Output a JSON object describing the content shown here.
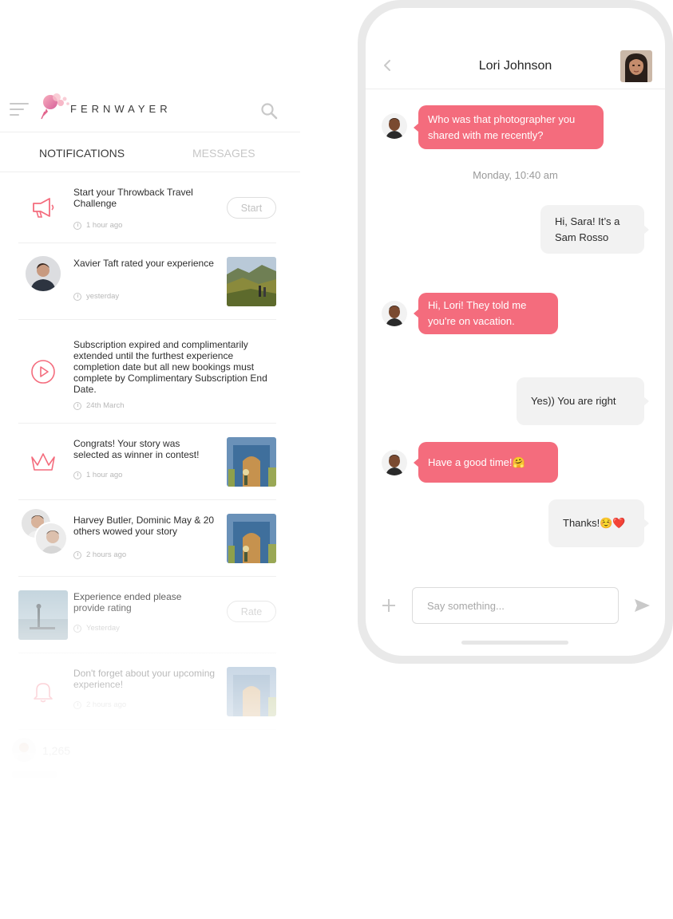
{
  "app": {
    "brand": "FERNWAYER",
    "tabs": [
      {
        "label": "NOTIFICATIONS",
        "active": true
      },
      {
        "label": "MESSAGES",
        "active": false
      }
    ]
  },
  "notifications": [
    {
      "text": "Start your Throwback Travel Challenge",
      "time": "1 hour ago",
      "icon": "megaphone-icon",
      "action": "Start"
    },
    {
      "text": "Xavier Taft rated your experience",
      "time": "yesterday",
      "icon": "user-avatar"
    },
    {
      "text": "Subscription expired and complimentarily extended until the furthest experience completion date but all new bookings must complete by Complimentary Subscription End Date.",
      "time": "24th March",
      "icon": "play-icon"
    },
    {
      "text": "Congrats! Your story was selected as winner in contest!",
      "time": "1 hour ago",
      "icon": "crown-icon"
    },
    {
      "text": "Harvey Butler, Dominic May & 20 others wowed your story",
      "time": "2 hours ago",
      "icon": "group-avatars"
    },
    {
      "text": "Experience ended please provide rating",
      "time": "Yesterday",
      "icon": "photo",
      "action": "Rate"
    },
    {
      "text": "Don't forget about your upcoming experience!",
      "time": "2 hours ago",
      "icon": "bell-icon"
    },
    {
      "text": "1,265",
      "time": "",
      "icon": "user-avatar"
    }
  ],
  "chat": {
    "contact_name": "Lori Johnson",
    "date_divider": "Monday, 10:40 am",
    "messages": [
      {
        "from": "them",
        "text": "Who was that photographer you shared with me recently?"
      },
      {
        "from": "me",
        "text": "Hi, Sara! It’s a Sam Rosso"
      },
      {
        "from": "them",
        "text": "Hi, Lori! They told me you're on vacation."
      },
      {
        "from": "me",
        "text": "Yes)) You are right"
      },
      {
        "from": "them",
        "text": "Have a good time!🤗"
      },
      {
        "from": "me",
        "text": "Thanks!☺️❤️"
      }
    ],
    "composer_placeholder": "Say something..."
  },
  "colors": {
    "accent": "#f46c7d",
    "bubble_out": "#f2f2f2",
    "phone_frame": "#e9e9e9",
    "muted_text": "#b8b8b8"
  }
}
